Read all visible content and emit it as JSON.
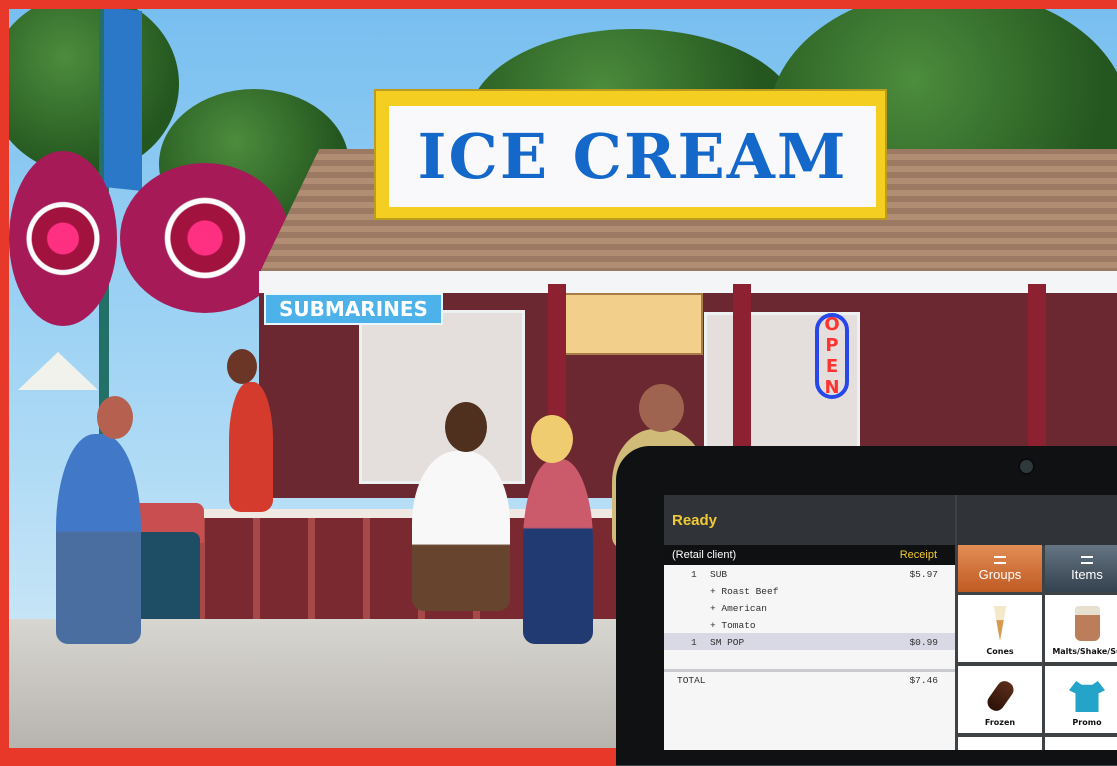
{
  "photo": {
    "main_sign": "ICE CREAM",
    "side_sign": "SUBMARINES",
    "open_sign": "OPEN"
  },
  "pos_screen": {
    "status": "Ready",
    "client": "(Retail client)",
    "receipt_label": "Receipt",
    "lines": [
      {
        "qty": "1",
        "name": "SUB",
        "price": "$5.97"
      },
      {
        "qty": "",
        "name": "+ Roast Beef",
        "price": ""
      },
      {
        "qty": "",
        "name": "+ American",
        "price": ""
      },
      {
        "qty": "",
        "name": "+ Tomato",
        "price": ""
      },
      {
        "qty": "1",
        "name": "SM POP",
        "price": "$0.99"
      }
    ],
    "total_label": "TOTAL",
    "total_value": "$7.46",
    "tabs": [
      {
        "label": "Groups"
      },
      {
        "label": "Items"
      }
    ],
    "tiles": [
      {
        "label": "Cones",
        "icon": "ice-cream-cone-icon"
      },
      {
        "label": "Malts/Shake/Su",
        "icon": "milkshake-icon"
      },
      {
        "label": "Frozen",
        "icon": "frozen-treat-icon"
      },
      {
        "label": "Promo",
        "icon": "t-shirt-icon"
      }
    ]
  }
}
